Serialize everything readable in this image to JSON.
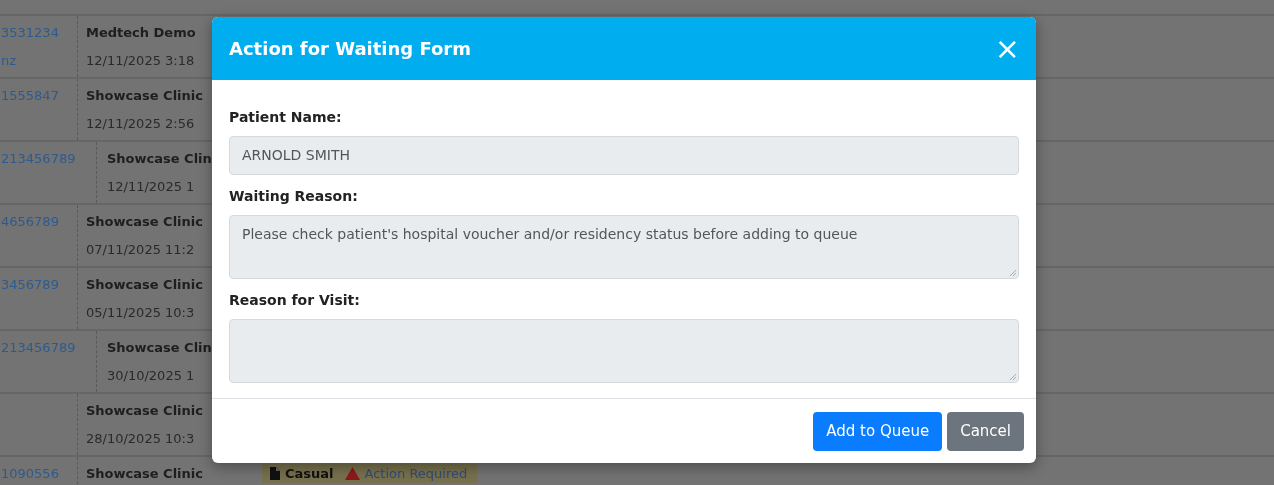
{
  "background_table": {
    "rows": [
      {
        "wide_id": false,
        "patient_id": "3531234",
        "patient_id_2": "nz",
        "clinic": "Medtech Demo",
        "date": "12/11/2025 3:18"
      },
      {
        "wide_id": false,
        "patient_id": "1555847",
        "clinic": "Showcase Clinic",
        "date": "12/11/2025 2:56"
      },
      {
        "wide_id": true,
        "patient_id": "213456789",
        "clinic": "Showcase Clin",
        "date": "12/11/2025 1"
      },
      {
        "wide_id": false,
        "patient_id": "4656789",
        "clinic": "Showcase Clinic",
        "date": "07/11/2025 11:2"
      },
      {
        "wide_id": false,
        "patient_id": "3456789",
        "clinic": "Showcase Clinic",
        "date": "05/11/2025 10:3"
      },
      {
        "wide_id": true,
        "patient_id": "213456789",
        "clinic": "Showcase Clin",
        "date": "30/10/2025 1"
      },
      {
        "wide_id": false,
        "clinic": "Showcase Clinic",
        "date": "28/10/2025 10:3"
      },
      {
        "wide_id": false,
        "patient_id": "1090556",
        "clinic": "Showcase Clinic",
        "badges": [
          {
            "kind": "type",
            "label": "Casual"
          },
          {
            "kind": "warning",
            "label": "Action Required"
          }
        ]
      }
    ]
  },
  "modal": {
    "title": "Action for Waiting Form",
    "close": "×",
    "fields": [
      {
        "label": "Patient Name:",
        "kind": "input",
        "value": "ARNOLD SMITH"
      },
      {
        "label": "Waiting Reason:",
        "kind": "textarea",
        "value": "Please check patient's hospital voucher and/or residency status before adding to queue"
      },
      {
        "label": "Reason for Visit:",
        "kind": "textarea"
      }
    ],
    "buttons": [
      {
        "label": "Add to Queue",
        "kind": "primary"
      },
      {
        "label": "Cancel",
        "kind": "secondary"
      }
    ]
  }
}
